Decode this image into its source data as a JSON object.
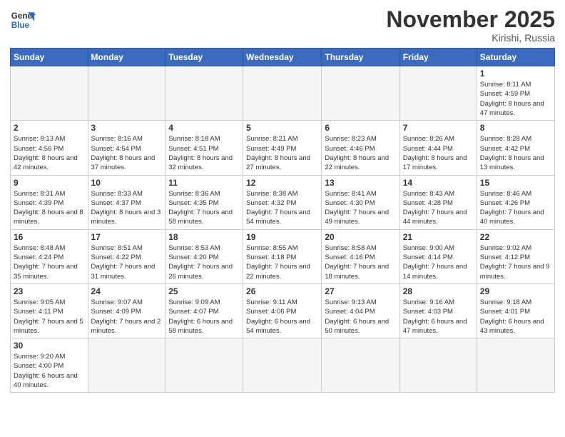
{
  "header": {
    "logo_general": "General",
    "logo_blue": "Blue",
    "month_title": "November 2025",
    "location": "Kirishi, Russia"
  },
  "weekdays": [
    "Sunday",
    "Monday",
    "Tuesday",
    "Wednesday",
    "Thursday",
    "Friday",
    "Saturday"
  ],
  "days": {
    "d1": {
      "num": "1",
      "sunrise": "8:11 AM",
      "sunset": "4:59 PM",
      "daylight": "8 hours and 47 minutes."
    },
    "d2": {
      "num": "2",
      "sunrise": "8:13 AM",
      "sunset": "4:56 PM",
      "daylight": "8 hours and 42 minutes."
    },
    "d3": {
      "num": "3",
      "sunrise": "8:16 AM",
      "sunset": "4:54 PM",
      "daylight": "8 hours and 37 minutes."
    },
    "d4": {
      "num": "4",
      "sunrise": "8:18 AM",
      "sunset": "4:51 PM",
      "daylight": "8 hours and 32 minutes."
    },
    "d5": {
      "num": "5",
      "sunrise": "8:21 AM",
      "sunset": "4:49 PM",
      "daylight": "8 hours and 27 minutes."
    },
    "d6": {
      "num": "6",
      "sunrise": "8:23 AM",
      "sunset": "4:46 PM",
      "daylight": "8 hours and 22 minutes."
    },
    "d7": {
      "num": "7",
      "sunrise": "8:26 AM",
      "sunset": "4:44 PM",
      "daylight": "8 hours and 17 minutes."
    },
    "d8": {
      "num": "8",
      "sunrise": "8:28 AM",
      "sunset": "4:42 PM",
      "daylight": "8 hours and 13 minutes."
    },
    "d9": {
      "num": "9",
      "sunrise": "8:31 AM",
      "sunset": "4:39 PM",
      "daylight": "8 hours and 8 minutes."
    },
    "d10": {
      "num": "10",
      "sunrise": "8:33 AM",
      "sunset": "4:37 PM",
      "daylight": "8 hours and 3 minutes."
    },
    "d11": {
      "num": "11",
      "sunrise": "8:36 AM",
      "sunset": "4:35 PM",
      "daylight": "7 hours and 58 minutes."
    },
    "d12": {
      "num": "12",
      "sunrise": "8:38 AM",
      "sunset": "4:32 PM",
      "daylight": "7 hours and 54 minutes."
    },
    "d13": {
      "num": "13",
      "sunrise": "8:41 AM",
      "sunset": "4:30 PM",
      "daylight": "7 hours and 49 minutes."
    },
    "d14": {
      "num": "14",
      "sunrise": "8:43 AM",
      "sunset": "4:28 PM",
      "daylight": "7 hours and 44 minutes."
    },
    "d15": {
      "num": "15",
      "sunrise": "8:46 AM",
      "sunset": "4:26 PM",
      "daylight": "7 hours and 40 minutes."
    },
    "d16": {
      "num": "16",
      "sunrise": "8:48 AM",
      "sunset": "4:24 PM",
      "daylight": "7 hours and 35 minutes."
    },
    "d17": {
      "num": "17",
      "sunrise": "8:51 AM",
      "sunset": "4:22 PM",
      "daylight": "7 hours and 31 minutes."
    },
    "d18": {
      "num": "18",
      "sunrise": "8:53 AM",
      "sunset": "4:20 PM",
      "daylight": "7 hours and 26 minutes."
    },
    "d19": {
      "num": "19",
      "sunrise": "8:55 AM",
      "sunset": "4:18 PM",
      "daylight": "7 hours and 22 minutes."
    },
    "d20": {
      "num": "20",
      "sunrise": "8:58 AM",
      "sunset": "4:16 PM",
      "daylight": "7 hours and 18 minutes."
    },
    "d21": {
      "num": "21",
      "sunrise": "9:00 AM",
      "sunset": "4:14 PM",
      "daylight": "7 hours and 14 minutes."
    },
    "d22": {
      "num": "22",
      "sunrise": "9:02 AM",
      "sunset": "4:12 PM",
      "daylight": "7 hours and 9 minutes."
    },
    "d23": {
      "num": "23",
      "sunrise": "9:05 AM",
      "sunset": "4:11 PM",
      "daylight": "7 hours and 5 minutes."
    },
    "d24": {
      "num": "24",
      "sunrise": "9:07 AM",
      "sunset": "4:09 PM",
      "daylight": "7 hours and 2 minutes."
    },
    "d25": {
      "num": "25",
      "sunrise": "9:09 AM",
      "sunset": "4:07 PM",
      "daylight": "6 hours and 58 minutes."
    },
    "d26": {
      "num": "26",
      "sunrise": "9:11 AM",
      "sunset": "4:06 PM",
      "daylight": "6 hours and 54 minutes."
    },
    "d27": {
      "num": "27",
      "sunrise": "9:13 AM",
      "sunset": "4:04 PM",
      "daylight": "6 hours and 50 minutes."
    },
    "d28": {
      "num": "28",
      "sunrise": "9:16 AM",
      "sunset": "4:03 PM",
      "daylight": "6 hours and 47 minutes."
    },
    "d29": {
      "num": "29",
      "sunrise": "9:18 AM",
      "sunset": "4:01 PM",
      "daylight": "6 hours and 43 minutes."
    },
    "d30": {
      "num": "30",
      "sunrise": "9:20 AM",
      "sunset": "4:00 PM",
      "daylight": "6 hours and 40 minutes."
    }
  }
}
